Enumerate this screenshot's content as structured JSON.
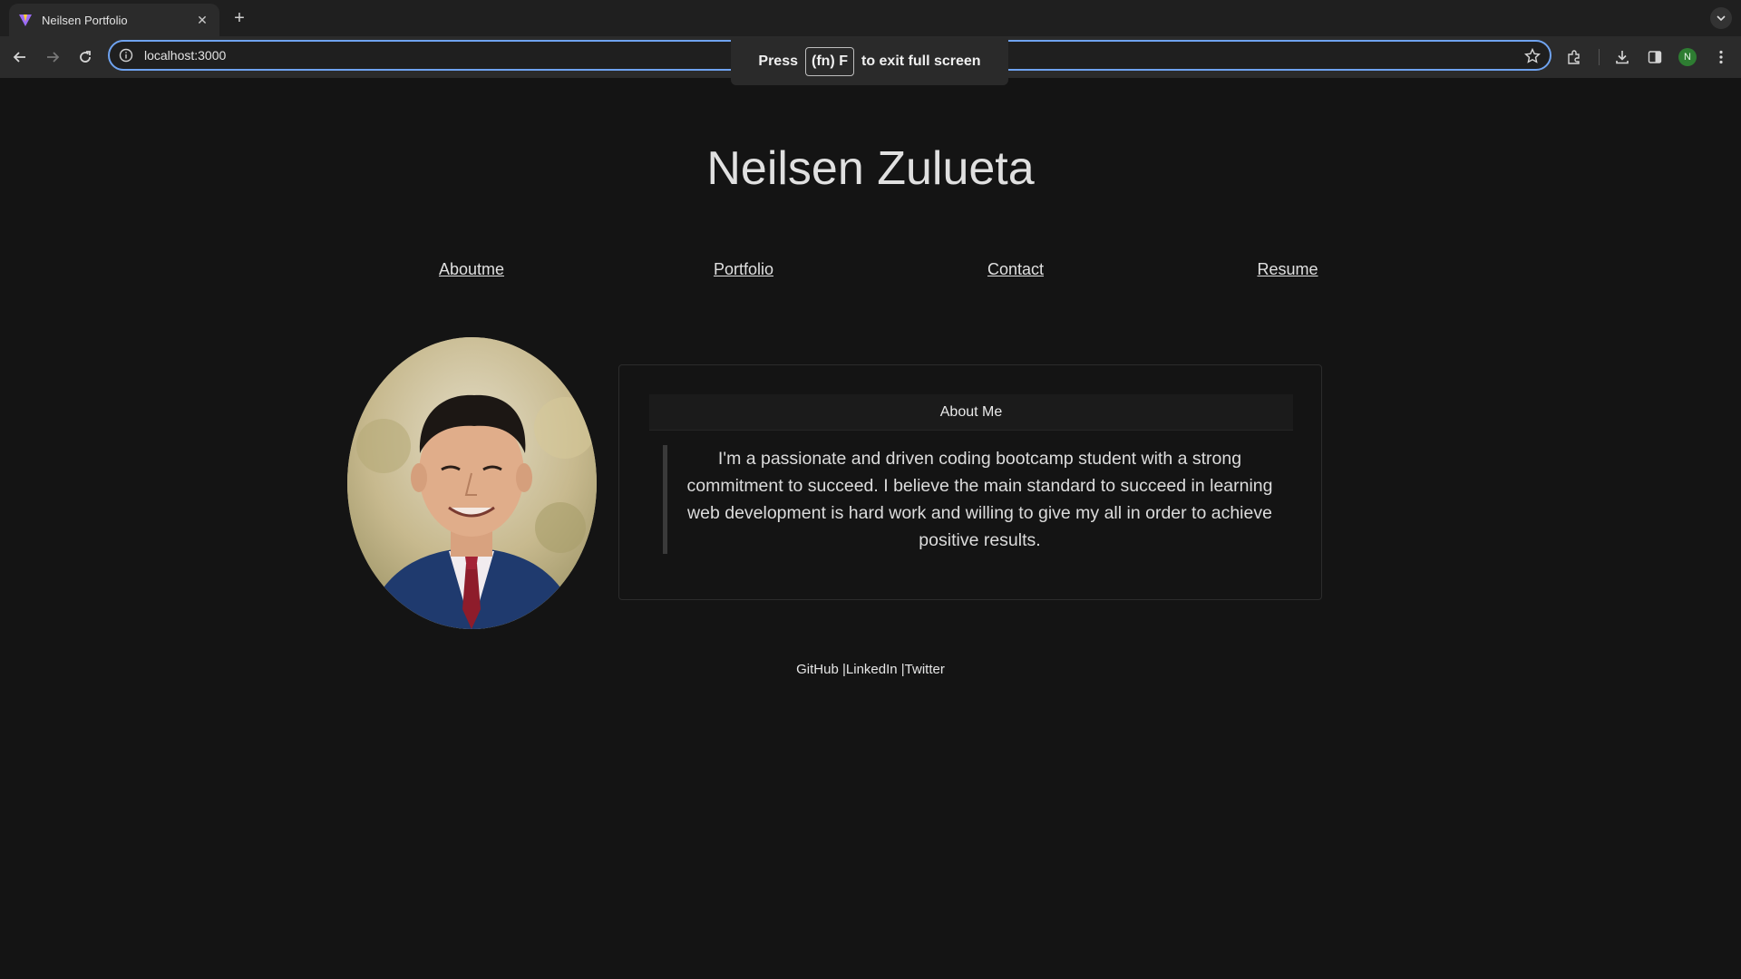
{
  "browser": {
    "tab_title": "Neilsen Portfolio",
    "url": "localhost:3000",
    "profile_initial": "N",
    "fullscreen_toast": {
      "prefix": "Press",
      "key": "(fn) F",
      "suffix": "to exit full screen"
    }
  },
  "site": {
    "title": "Neilsen Zulueta",
    "nav": [
      "Aboutme",
      "Portfolio",
      "Contact",
      "Resume"
    ]
  },
  "about": {
    "heading": "About Me",
    "text": "I'm a passionate and driven coding bootcamp student with a strong commitment to succeed. I believe the main standard to succeed in learning web development is hard work and willing to give my all in order to achieve positive results."
  },
  "footer": {
    "links": [
      "GitHub |",
      "LinkedIn |",
      "Twitter"
    ]
  },
  "colors": {
    "page_bg": "#141414",
    "omnibox_focus": "#6fa3f0",
    "profile_bg": "#2e7d32"
  }
}
